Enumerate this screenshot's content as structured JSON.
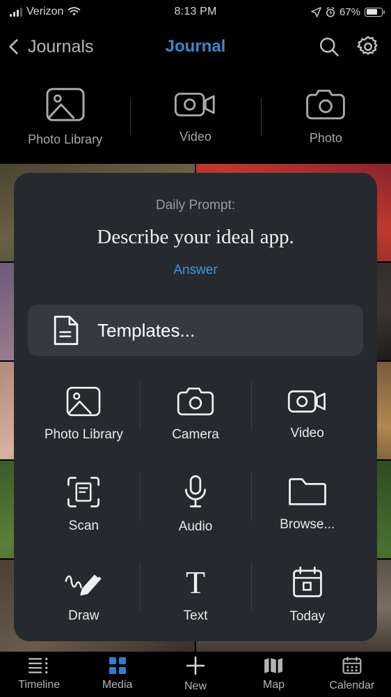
{
  "status_bar": {
    "carrier": "Verizon",
    "time": "8:13 PM",
    "battery_percent": "67%",
    "icons": [
      "cellular-signal-icon",
      "wifi-icon",
      "location-arrow-icon",
      "alarm-icon",
      "battery-icon"
    ]
  },
  "nav_bar": {
    "back_label": "Journals",
    "title": "Journal",
    "search_icon": "search-icon",
    "settings_icon": "gear-icon"
  },
  "quick_strip": {
    "items": [
      {
        "label": "Photo Library",
        "icon": "photo-library-icon"
      },
      {
        "label": "Video",
        "icon": "video-camera-icon"
      },
      {
        "label": "Photo",
        "icon": "camera-icon"
      }
    ]
  },
  "sheet": {
    "prompt_kicker": "Daily Prompt:",
    "prompt_text": "Describe your ideal app.",
    "answer_label": "Answer",
    "templates_label": "Templates...",
    "templates_icon": "document-icon",
    "options": [
      {
        "label": "Photo Library",
        "icon": "photo-library-icon"
      },
      {
        "label": "Camera",
        "icon": "camera-icon"
      },
      {
        "label": "Video",
        "icon": "video-camera-icon"
      },
      {
        "label": "Scan",
        "icon": "document-scan-icon"
      },
      {
        "label": "Audio",
        "icon": "microphone-icon"
      },
      {
        "label": "Browse...",
        "icon": "folder-icon"
      },
      {
        "label": "Draw",
        "icon": "pencil-squiggle-icon"
      },
      {
        "label": "Text",
        "icon": "text-t-icon"
      },
      {
        "label": "Today",
        "icon": "calendar-day-icon"
      }
    ]
  },
  "tab_bar": {
    "active": "Media",
    "tabs": [
      {
        "label": "Timeline",
        "icon": "timeline-list-icon"
      },
      {
        "label": "Media",
        "icon": "media-grid-icon"
      },
      {
        "label": "New",
        "icon": "plus-icon"
      },
      {
        "label": "Map",
        "icon": "map-icon"
      },
      {
        "label": "Calendar",
        "icon": "calendar-icon"
      }
    ]
  },
  "colors": {
    "accent_blue": "#3f87c9",
    "answer_blue": "#3f97dd",
    "media_active_blue": "#2f7fd0",
    "sheet_bg": "#262a2e",
    "templates_bg": "#343a42"
  }
}
